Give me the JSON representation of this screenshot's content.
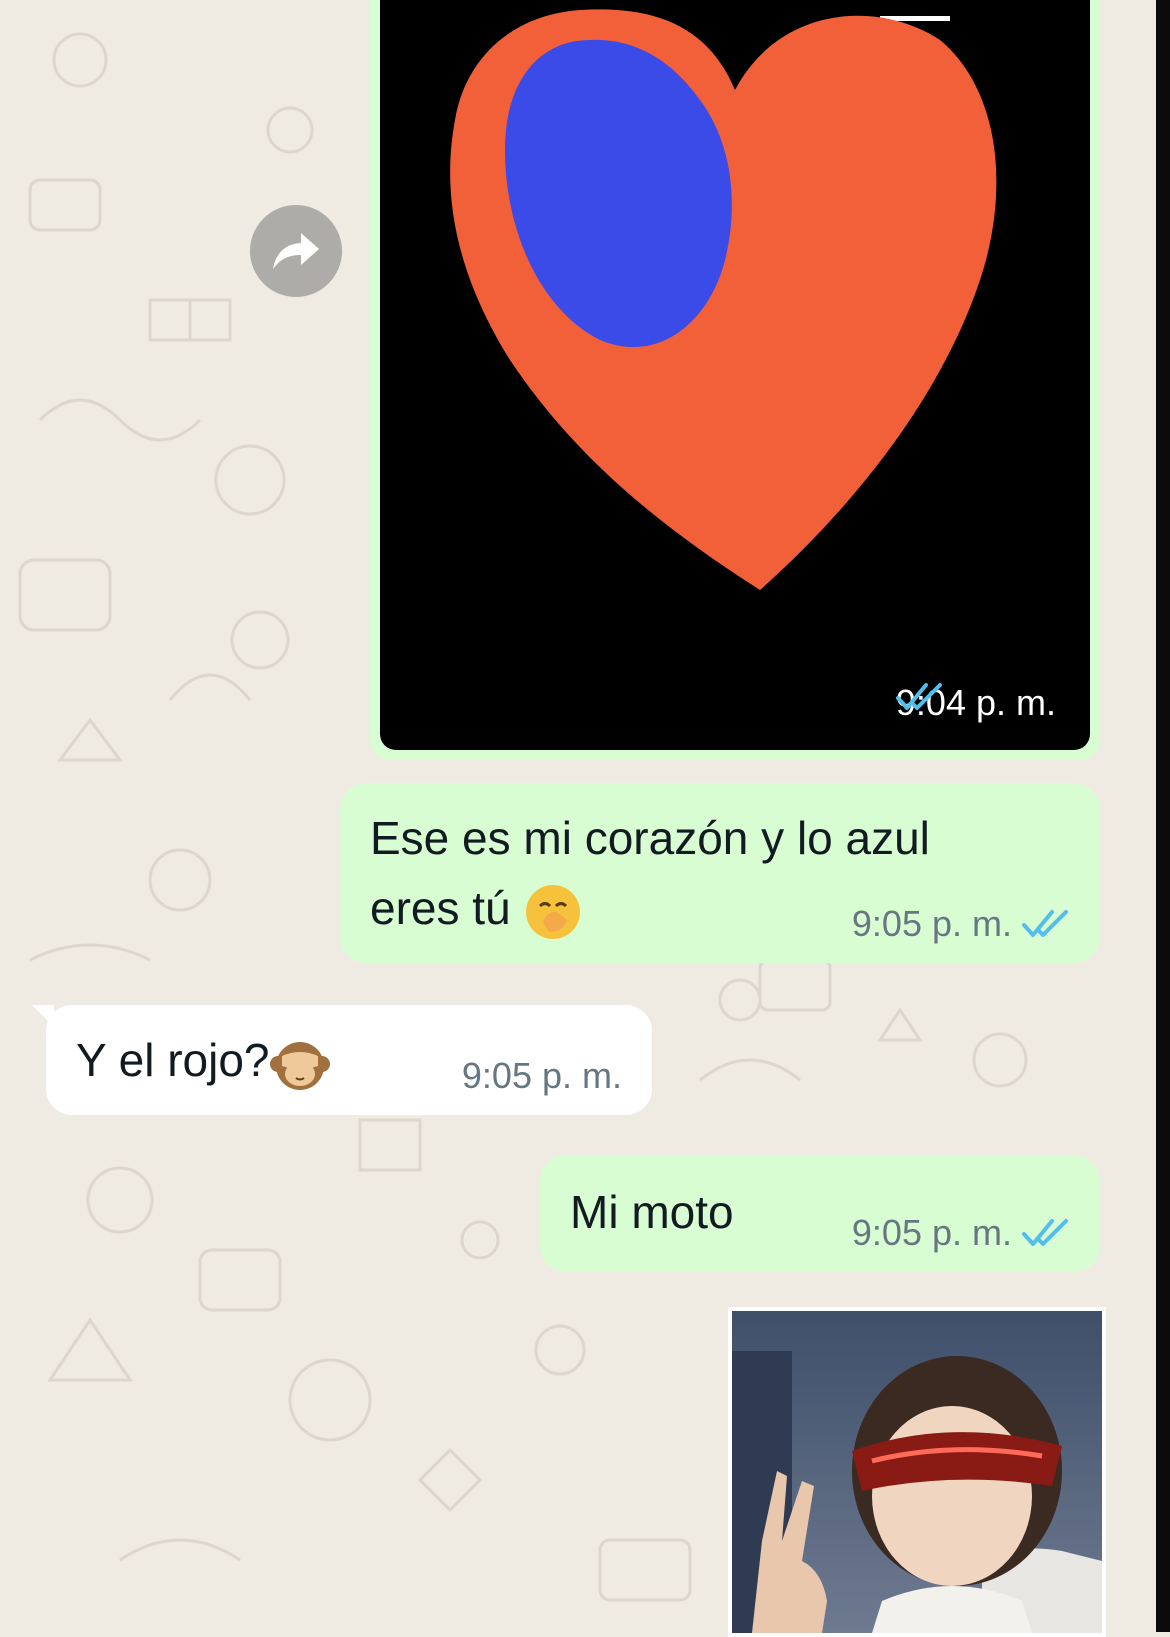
{
  "messages": [
    {
      "type": "image",
      "direction": "outgoing",
      "time": "9:04 p. m.",
      "status": "read-double-check"
    },
    {
      "type": "text",
      "direction": "outgoing",
      "text_line1": "Ese es mi corazón y lo azul",
      "text_line2": "eres tú",
      "emoji": "hand-over-mouth",
      "time": "9:05 p. m.",
      "status": "read-double-check"
    },
    {
      "type": "text",
      "direction": "incoming",
      "text": "Y el rojo?",
      "emoji": "see-no-evil-monkey",
      "time": "9:05 p. m."
    },
    {
      "type": "text",
      "direction": "outgoing",
      "text": "Mi moto",
      "time": "9:05 p. m.",
      "status": "read-double-check"
    },
    {
      "type": "image",
      "direction": "outgoing"
    }
  ],
  "colors": {
    "chat_background": "#efeae2",
    "outgoing_bubble": "#d9fdd3",
    "incoming_bubble": "#ffffff",
    "read_check": "#53bdeb",
    "heart_red": "#f2603a",
    "heart_blue": "#3a4be8"
  },
  "icons": {
    "forward": "forward-arrow-icon",
    "read": "double-check-icon"
  }
}
